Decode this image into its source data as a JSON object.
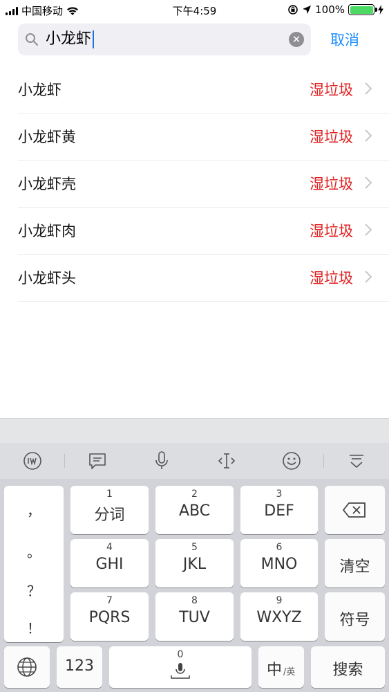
{
  "status_bar": {
    "carrier": "中国移动",
    "time": "下午4:59",
    "battery": "100%"
  },
  "search": {
    "query": "小龙虾",
    "cancel_label": "取消"
  },
  "results": [
    {
      "name": "小龙虾",
      "category": "湿垃圾"
    },
    {
      "name": "小龙虾黄",
      "category": "湿垃圾"
    },
    {
      "name": "小龙虾壳",
      "category": "湿垃圾"
    },
    {
      "name": "小龙虾肉",
      "category": "湿垃圾"
    },
    {
      "name": "小龙虾头",
      "category": "湿垃圾"
    }
  ],
  "keyboard": {
    "toolbar_icons": [
      "ime-logo-icon",
      "clipboard-message-icon",
      "microphone-icon",
      "cursor-move-icon",
      "emoji-icon",
      "hide-keyboard-icon"
    ],
    "punctuation": [
      "，",
      "。",
      "？",
      "！"
    ],
    "keys": {
      "k1": {
        "num": "1",
        "label": "分词"
      },
      "k2": {
        "num": "2",
        "label": "ABC"
      },
      "k3": {
        "num": "3",
        "label": "DEF"
      },
      "k4": {
        "num": "4",
        "label": "GHI"
      },
      "k5": {
        "num": "5",
        "label": "JKL"
      },
      "k6": {
        "num": "6",
        "label": "MNO"
      },
      "k7": {
        "num": "7",
        "label": "PQRS"
      },
      "k8": {
        "num": "8",
        "label": "TUV"
      },
      "k9": {
        "num": "9",
        "label": "WXYZ"
      },
      "k0": {
        "num": "0"
      }
    },
    "clear_label": "清空",
    "symbol_label": "符号",
    "numbers_label": "123",
    "lang_label_main": "中",
    "lang_label_sub": "/英",
    "search_label": "搜索"
  },
  "colors": {
    "accent": "#1a8cff",
    "category_red": "#e02020",
    "battery_green": "#4cd964"
  }
}
